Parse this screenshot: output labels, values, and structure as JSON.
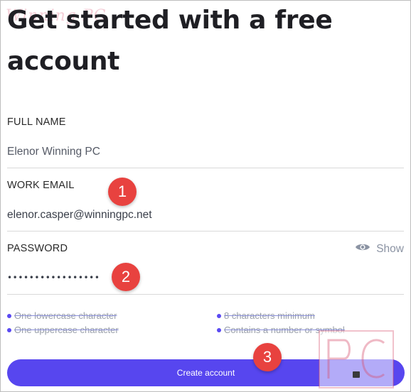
{
  "logo_text": "Winning PC",
  "title": "Get started with a free account",
  "full_name": {
    "label": "FULL NAME",
    "value": "Elenor Winning PC"
  },
  "work_email": {
    "label": "WORK EMAIL",
    "value": "elenor.casper@winningpc.net"
  },
  "password": {
    "label": "PASSWORD",
    "masked_value": "•••••••••••••••••",
    "show_label": "Show",
    "show_icon": "eye-icon"
  },
  "requirements": [
    {
      "text": "One lowercase character"
    },
    {
      "text": "8 characters minimum"
    },
    {
      "text": "One uppercase character"
    },
    {
      "text": "Contains a number or symbol"
    }
  ],
  "create_button": {
    "label": "Create account"
  },
  "badges": [
    "1",
    "2",
    "3"
  ],
  "colors": {
    "accent": "#5746ef",
    "badge": "#e8423f",
    "requirement_dot": "#5a49f2"
  }
}
